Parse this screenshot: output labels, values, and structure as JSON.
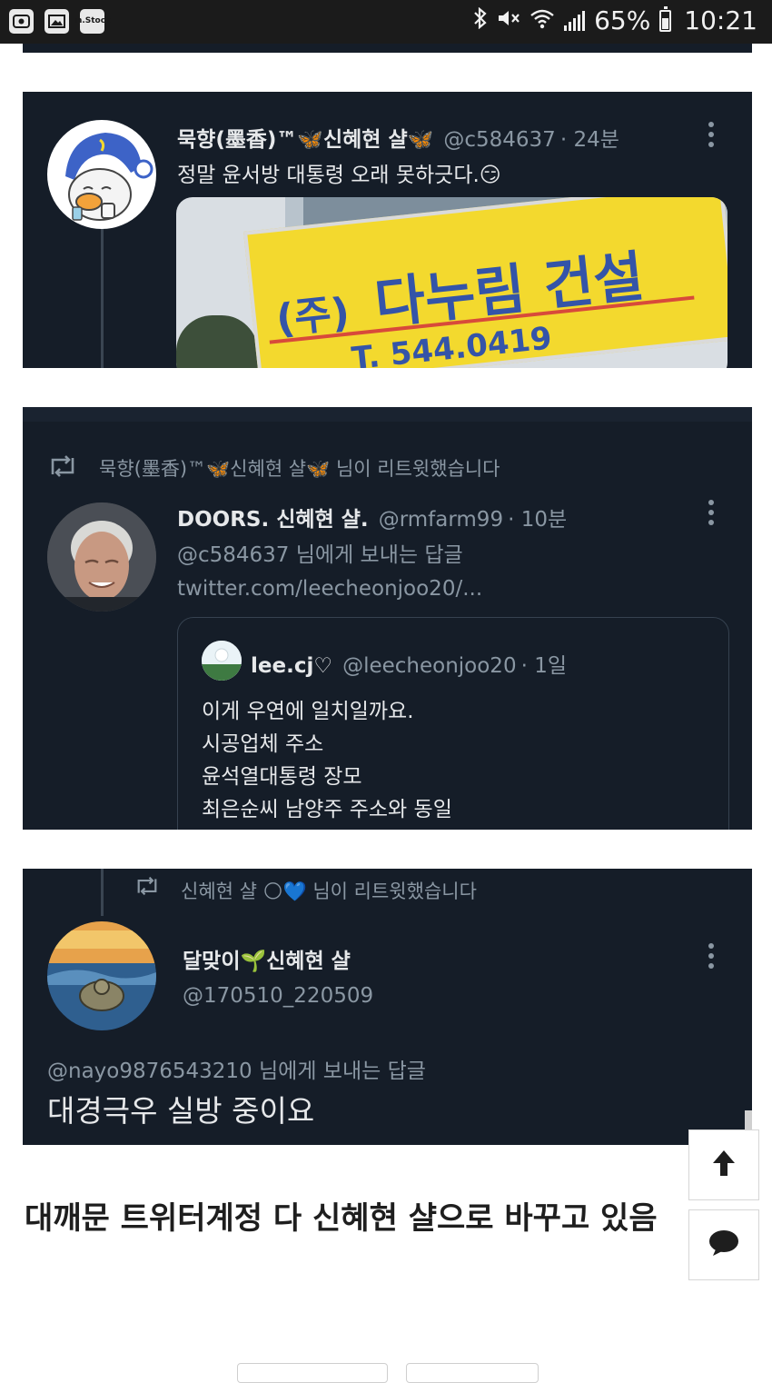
{
  "status_bar": {
    "left_icons": [
      "screen-record-icon",
      "gallery-icon",
      "mstock-icon"
    ],
    "mstock_label": "m.Stock",
    "battery_percent": "65%",
    "battery_level": 0.65,
    "time": "10:21"
  },
  "tweet1": {
    "display_name": "묵향(墨香)™🦋신혜현 샬🦋",
    "handle": "@c584637",
    "age": "· 24분",
    "text": "정말 윤서방 대통령 오래 못하긋다.😏",
    "image": {
      "sign_prefix": "(주)",
      "sign_name": "다누림 건설",
      "sign_phone": "T. 544.0419"
    }
  },
  "tweet2": {
    "retweet_notice": "묵향(墨香)™🦋신혜현 샬🦋 님이 리트윗했습니다",
    "display_name": "DOORS. 신혜현 샬.",
    "handle": "@rmfarm99",
    "age": "· 10분",
    "reply_to": "@c584637 님에게 보내는 답글",
    "link": "twitter.com/leecheonjoo20/...",
    "quote": {
      "display_name": "lee.cj♡",
      "handle": "@leecheonjoo20",
      "age": "· 1일",
      "lines": [
        "이게 우연에 일치일까요.",
        "시공업체 주소",
        "윤석열대통령 장모",
        "최은순씨 남양주 주소와 동일"
      ]
    }
  },
  "tweet3": {
    "retweet_notice": "신혜현 샬 🌕💙 님이 리트윗했습니다",
    "display_name": "달맞이🌱신혜현 샬",
    "handle": "@170510_220509",
    "reply_to": "@nayo9876543210 님에게 보내는 답글",
    "text": "대경극우 실방 중이요"
  },
  "caption": "대깨문 트위터계정 다 신혜현 샬으로 바꾸고 있음",
  "colors": {
    "tweet_bg": "#151d28",
    "text_primary": "#e6e8ea",
    "text_secondary": "#8a97a3",
    "sign_yellow": "#f3d92e",
    "sign_blue": "#3454a8"
  }
}
